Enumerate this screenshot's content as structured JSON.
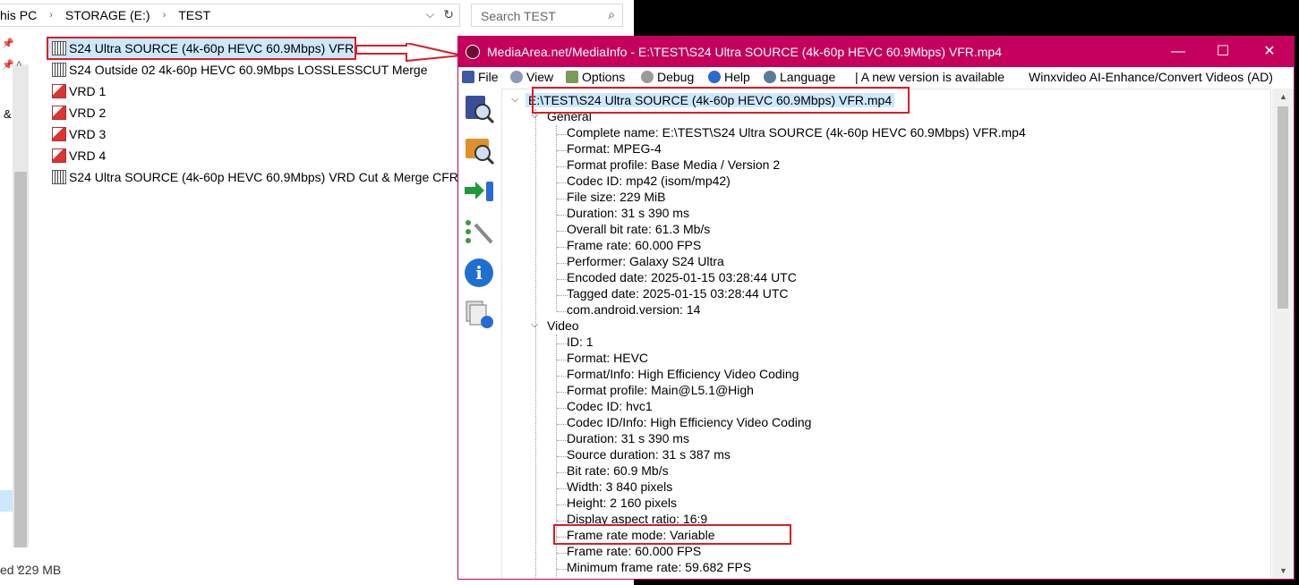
{
  "explorer": {
    "breadcrumb": [
      "his PC",
      "STORAGE (E:)",
      "TEST"
    ],
    "search_placeholder": "Search TEST",
    "nav_fragment": "&",
    "files": [
      {
        "name": "S24 Ultra SOURCE (4k-60p HEVC 60.9Mbps) VFR",
        "icon": "video-file-icon",
        "selected": true
      },
      {
        "name": "S24 Outside 02 4k-60p HEVC 60.9Mbps LOSSLESSCUT Merge",
        "icon": "video-file-icon"
      },
      {
        "name": "VRD 1",
        "icon": "image-file-icon"
      },
      {
        "name": "VRD 2",
        "icon": "image-file-icon"
      },
      {
        "name": "VRD 3",
        "icon": "image-file-icon"
      },
      {
        "name": "VRD 4",
        "icon": "image-file-icon"
      },
      {
        "name": "S24 Ultra SOURCE (4k-60p HEVC 60.9Mbps) VRD Cut & Merge CFR",
        "icon": "video-file-icon"
      }
    ],
    "status": {
      "fragment": "ed",
      "size": "229 MB"
    }
  },
  "mediainfo": {
    "title": "MediaArea.net/MediaInfo - E:\\TEST\\S24 Ultra SOURCE (4k-60p HEVC 60.9Mbps) VFR.mp4",
    "window_controls": {
      "minimize": "—",
      "maximize": "☐",
      "close": "✕"
    },
    "menu": {
      "file": "File",
      "view": "View",
      "options": "Options",
      "debug": "Debug",
      "help": "Help",
      "language": "Language",
      "new_version": "| A new version is available",
      "ad": "Winxvideo AI-Enhance/Convert Videos (AD)"
    },
    "root": "E:\\TEST\\S24 Ultra SOURCE (4k-60p HEVC 60.9Mbps) VFR.mp4",
    "general": {
      "label": "General",
      "items": [
        "Complete name: E:\\TEST\\S24 Ultra SOURCE (4k-60p HEVC 60.9Mbps) VFR.mp4",
        "Format: MPEG-4",
        "Format profile: Base Media / Version 2",
        "Codec ID: mp42 (isom/mp42)",
        "File size: 229 MiB",
        "Duration: 31 s 390 ms",
        "Overall bit rate: 61.3 Mb/s",
        "Frame rate: 60.000 FPS",
        "Performer: Galaxy S24 Ultra",
        "Encoded date: 2025-01-15 03:28:44 UTC",
        "Tagged date: 2025-01-15 03:28:44 UTC",
        "com.android.version: 14"
      ]
    },
    "video": {
      "label": "Video",
      "items": [
        "ID: 1",
        "Format: HEVC",
        "Format/Info: High Efficiency Video Coding",
        "Format profile: Main@L5.1@High",
        "Codec ID: hvc1",
        "Codec ID/Info: High Efficiency Video Coding",
        "Duration: 31 s 390 ms",
        "Source duration: 31 s 387 ms",
        "Bit rate: 60.9 Mb/s",
        "Width: 3 840 pixels",
        "Height: 2 160 pixels",
        "Display aspect ratio: 16:9",
        "Frame rate mode: Variable",
        "Frame rate: 60.000 FPS",
        "Minimum frame rate: 59.682 FPS"
      ]
    }
  },
  "colors": {
    "accent": "#c4005c",
    "highlight": "#d81f26",
    "selection": "#cce8ff"
  }
}
